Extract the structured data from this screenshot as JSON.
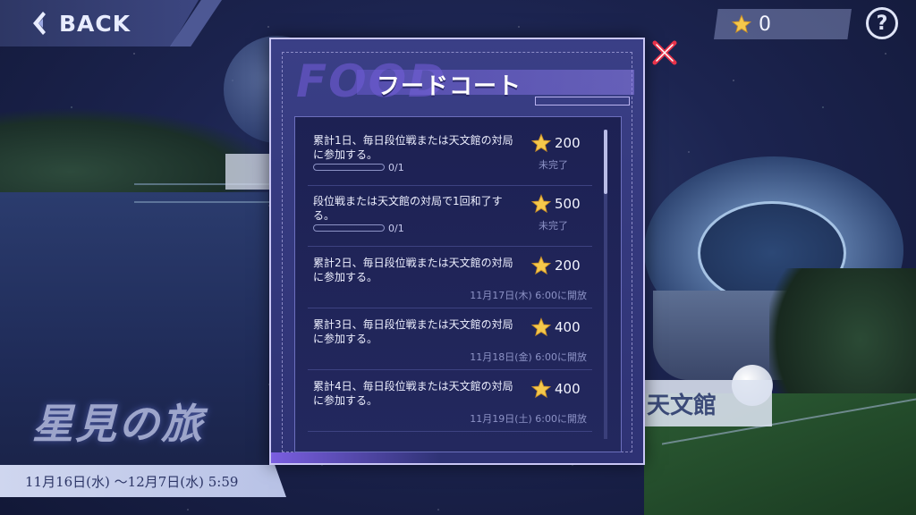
{
  "topbar": {
    "back_label": "BACK",
    "star_count": "0",
    "help_label": "?"
  },
  "background": {
    "event_title": "星見の旅",
    "date_range": "11月16日(水) ～12月7日(水) 5:59",
    "building_sign": "天文館"
  },
  "dialog": {
    "watermark": "FOOD",
    "title": "フードコート",
    "missions": [
      {
        "desc": "累計1日、毎日段位戦または天文館の対局に参加する。",
        "reward": "200",
        "status": "未完了",
        "progress_text": "0/1",
        "progress": 0
      },
      {
        "desc": "段位戦または天文館の対局で1回和了する。",
        "reward": "500",
        "status": "未完了",
        "progress_text": "0/1",
        "progress": 0
      },
      {
        "desc": "累計2日、毎日段位戦または天文館の対局に参加する。",
        "reward": "200",
        "opens": "11月17日(木) 6:00に開放"
      },
      {
        "desc": "累計3日、毎日段位戦または天文館の対局に参加する。",
        "reward": "400",
        "opens": "11月18日(金) 6:00に開放"
      },
      {
        "desc": "累計4日、毎日段位戦または天文館の対局に参加する。",
        "reward": "400",
        "opens": "11月19日(土) 6:00に開放"
      }
    ]
  },
  "colors": {
    "star": "#f5c84b",
    "close": "#e8334a",
    "dialog_bg": "#34397c"
  }
}
